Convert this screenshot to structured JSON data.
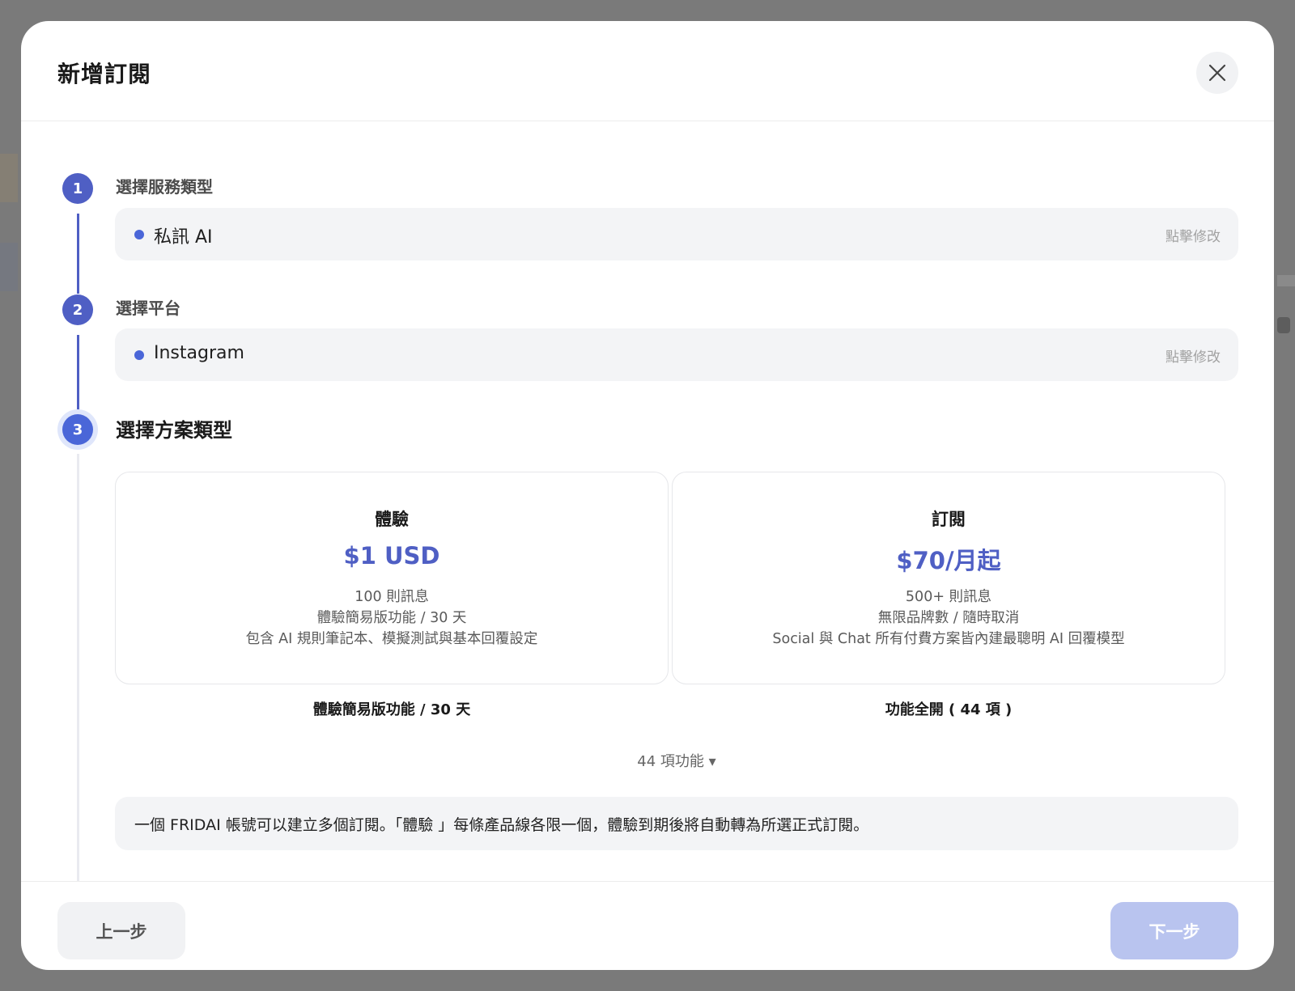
{
  "modal": {
    "title": "新增訂閱",
    "close_icon": "close-icon"
  },
  "steps": [
    {
      "number": "1",
      "label": "選擇服務類型",
      "selected": "私訊 AI",
      "edit": "點擊修改"
    },
    {
      "number": "2",
      "label": "選擇平台",
      "selected": "Instagram",
      "edit": "點擊修改"
    },
    {
      "number": "3",
      "label": "選擇方案類型"
    }
  ],
  "plans": [
    {
      "name": "體驗",
      "price": "$1 USD",
      "lines": [
        "100 則訊息",
        "體驗簡易版功能 / 30 天",
        "包含 AI 規則筆記本、模擬測試與基本回覆設定"
      ],
      "summary": "體驗簡易版功能 / 30 天"
    },
    {
      "name": "訂閱",
      "price": "$70/月起",
      "lines": [
        "500+ 則訊息",
        "無限品牌數 / 隨時取消",
        "Social 與 Chat 所有付費方案皆內建最聰明 AI 回覆模型"
      ],
      "summary": "功能全開 ( 44 項 )"
    }
  ],
  "feature_toggle": "44 項功能 ▾",
  "info": "一個 FRIDAI 帳號可以建立多個訂閱。「體驗 」每條產品線各限一個，體驗到期後將自動轉為所選正式訂閱。",
  "footer": {
    "prev_label": "上一步",
    "next_label": "下一步"
  },
  "colors": {
    "accent": "#4f5fc4",
    "active_step": "#4a66d8",
    "next_disabled": "#b9c4ef",
    "backdrop": "#7a7a7a"
  }
}
